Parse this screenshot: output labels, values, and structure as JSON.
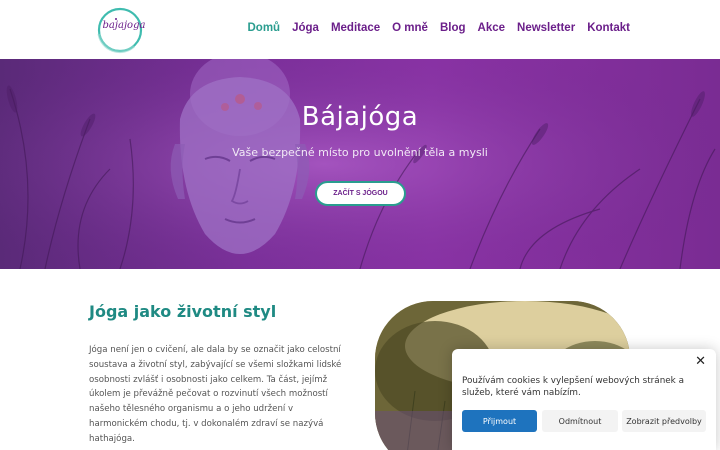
{
  "logo": {
    "text": "bajajoga"
  },
  "nav": {
    "items": [
      "Domů",
      "Jóga",
      "Meditace",
      "O mně",
      "Blog",
      "Akce",
      "Newsletter",
      "Kontakt"
    ]
  },
  "hero": {
    "title": "Bájajóga",
    "subtitle": "Vaše bezpečné místo pro uvolnění těla a mysli",
    "button_label": "ZAČÍT S JÓGOU"
  },
  "section": {
    "title": "Jóga jako životní styl",
    "text": "Jóga není jen o cvičení, ale dala by se označit jako celostní soustava a životní styl, zabývající se všemi složkami lidské osobnosti zvlášť i osobnosti jako celkem. Ta část, jejímž úkolem je převážně pečovat o rozvinutí všech možností našeho tělesného organismu a o jeho udržení v harmonickém chodu, tj. v dokonalém zdraví se nazývá hathajóga."
  },
  "cookie": {
    "text": "Používám cookies k vylepšení webových stránek a služeb, které vám nabízím.",
    "accept_label": "Přijmout",
    "deny_label": "Odmítnout",
    "prefs_label": "Zobrazit předvolby",
    "close_symbol": "✕"
  },
  "colors": {
    "brand_purple": "#6b1f8a",
    "accent_teal": "#2a9d8f",
    "accept_blue": "#1e73be"
  }
}
